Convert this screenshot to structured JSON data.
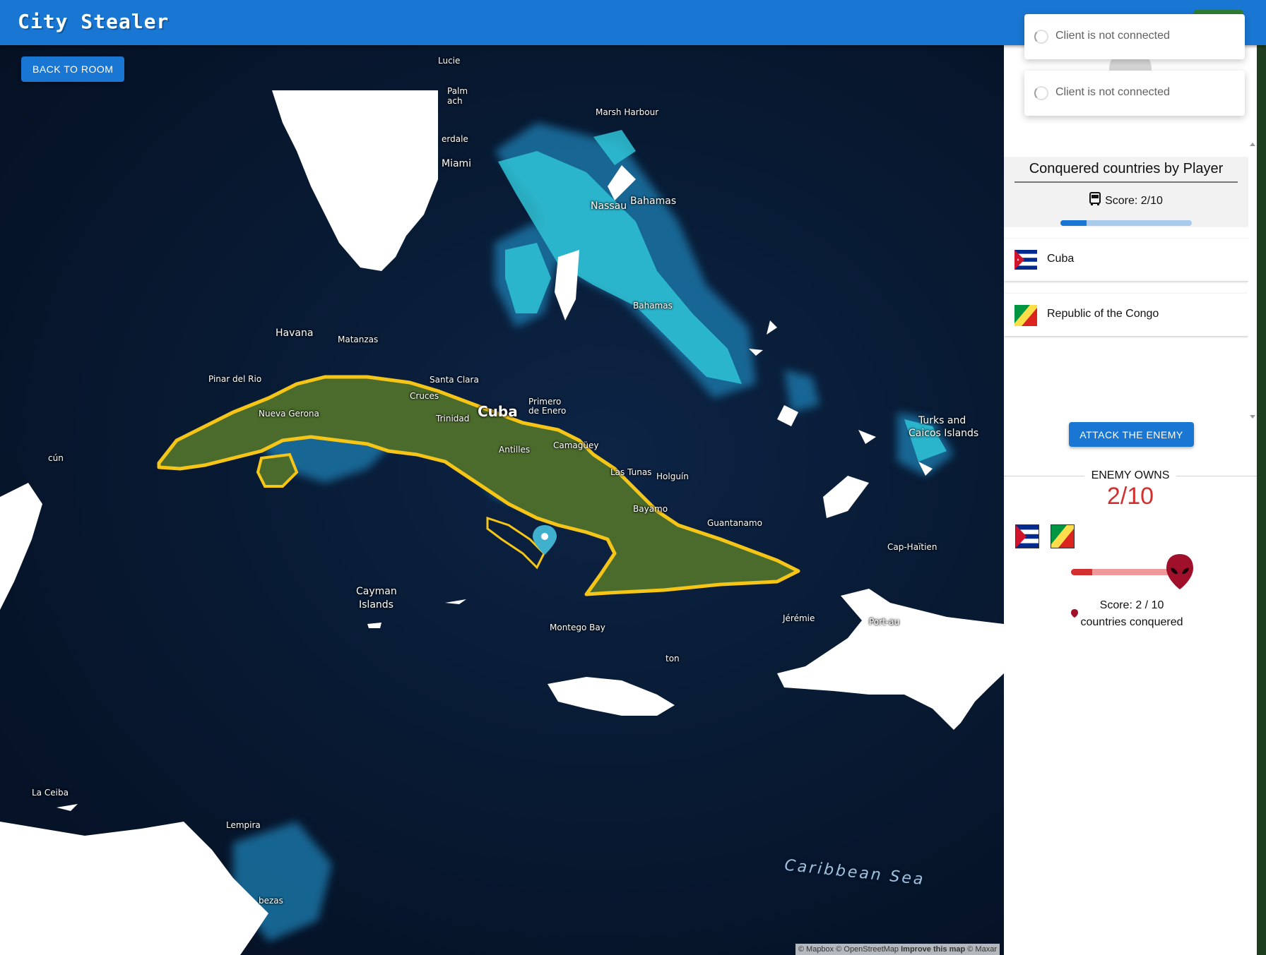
{
  "app": {
    "title": "City Stealer"
  },
  "map": {
    "back_button": "BACK TO ROOM",
    "labels": {
      "lucie": "Lucie",
      "palm": "Palm",
      "beach": "ach",
      "lauderdale": "erdale",
      "miami": "Miami",
      "marsh_harbour": "Marsh Harbour",
      "nassau": "Nassau",
      "bahamas": "Bahamas",
      "bahamas_small": "Bahamas",
      "havana": "Havana",
      "matanzas": "Matanzas",
      "pinar": "Pinar del Rio",
      "nueva_gerona": "Nueva Gerona",
      "santa_clara": "Santa Clara",
      "cruces": "Cruces",
      "trinidad": "Trinidad",
      "cuba": "Cuba",
      "primero": "Primero",
      "de_enero": "de Enero",
      "antilles": "Antilles",
      "camaguey": "Camagüey",
      "las_tunas": "Las Tunas",
      "holguin": "Holguín",
      "bayamo": "Bayamo",
      "guantanamo": "Guantanamo",
      "turks1": "Turks and",
      "turks2": "Caicos Islands",
      "cancun": "cún",
      "cayman1": "Cayman",
      "cayman2": "Islands",
      "montego": "Montego Bay",
      "kingston": "ton",
      "jeremie": "Jérémie",
      "port": "Port-au",
      "cap": "Cap-Haïtien",
      "la_ceiba": "La Ceiba",
      "lempira": "Lempira",
      "cabezas": "bezas",
      "caribbean": "Caribbean Sea"
    },
    "attribution": {
      "mapbox": "© Mapbox",
      "osm": "© OpenStreetMap",
      "improve": "Improve this map",
      "maxar": "© Maxar"
    }
  },
  "notifications": [
    {
      "text": "Client is not connected"
    },
    {
      "text": "Client is not connected"
    }
  ],
  "player_panel": {
    "title": "Conquered countries by Player",
    "score_text": "Score: 2/10",
    "score": 2,
    "score_max": 10,
    "countries": [
      {
        "name": "Cuba",
        "flag": "cuba-flag"
      },
      {
        "name": "Republic of the Congo",
        "flag": "congo-flag"
      }
    ]
  },
  "attack_button": "ATTACK THE ENEMY",
  "enemy": {
    "title": "ENEMY OWNS",
    "ratio": "2/10",
    "score_line": "Score: 2 / 10",
    "subtitle": "countries conquered",
    "score": 2,
    "score_max": 10,
    "flags": [
      "cuba-flag",
      "congo-flag"
    ]
  },
  "colors": {
    "primary": "#1976d2",
    "enemy": "#d32f2f",
    "cuba_outline": "#f5c518"
  }
}
